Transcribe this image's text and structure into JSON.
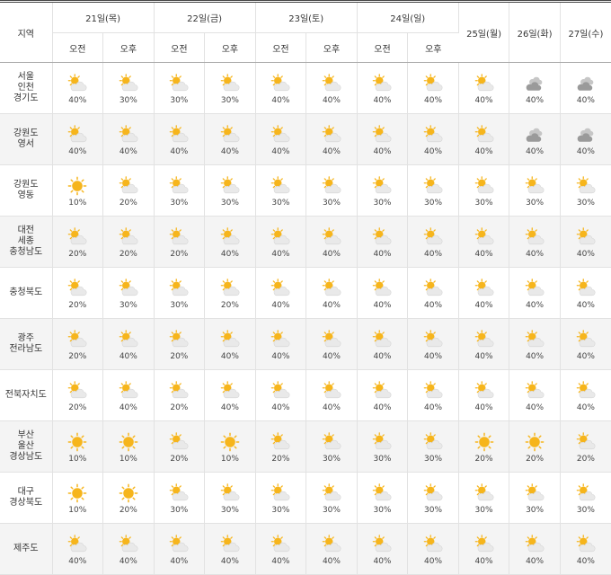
{
  "header": {
    "region_label": "지역",
    "am_label": "오전",
    "pm_label": "오후",
    "days_split": [
      "21일(목)",
      "22일(금)",
      "23일(토)",
      "24일(일)"
    ],
    "days_single": [
      "25일(월)",
      "26일(화)",
      "27일(수)"
    ]
  },
  "colors": {
    "sun": "#f6b51c",
    "cloud": "#e9e9e9",
    "cloud_dark": "#9a9a9a",
    "border": "#e2e2e2",
    "alt_row": "#f4f4f4"
  },
  "rows": [
    {
      "region": "서울\n인천\n경기도",
      "icons": [
        "partly-cloudy",
        "partly-cloudy",
        "partly-cloudy",
        "partly-cloudy",
        "partly-cloudy",
        "partly-cloudy",
        "partly-cloudy",
        "partly-cloudy",
        "partly-cloudy",
        "cloudy",
        "cloudy"
      ],
      "pops": [
        "40%",
        "30%",
        "30%",
        "30%",
        "40%",
        "40%",
        "40%",
        "40%",
        "40%",
        "40%",
        "40%"
      ]
    },
    {
      "region": "강원도\n영서",
      "icons": [
        "partly-cloudy",
        "partly-cloudy",
        "partly-cloudy",
        "partly-cloudy",
        "partly-cloudy",
        "partly-cloudy",
        "partly-cloudy",
        "partly-cloudy",
        "partly-cloudy",
        "cloudy",
        "cloudy"
      ],
      "pops": [
        "40%",
        "40%",
        "40%",
        "40%",
        "40%",
        "40%",
        "40%",
        "40%",
        "40%",
        "40%",
        "40%"
      ]
    },
    {
      "region": "강원도\n영동",
      "icons": [
        "sunny",
        "partly-cloudy",
        "partly-cloudy",
        "partly-cloudy",
        "partly-cloudy",
        "partly-cloudy",
        "partly-cloudy",
        "partly-cloudy",
        "partly-cloudy",
        "partly-cloudy",
        "partly-cloudy"
      ],
      "pops": [
        "10%",
        "20%",
        "30%",
        "30%",
        "30%",
        "30%",
        "30%",
        "30%",
        "30%",
        "30%",
        "30%"
      ]
    },
    {
      "region": "대전\n세종\n충청남도",
      "icons": [
        "partly-cloudy",
        "partly-cloudy",
        "partly-cloudy",
        "partly-cloudy",
        "partly-cloudy",
        "partly-cloudy",
        "partly-cloudy",
        "partly-cloudy",
        "partly-cloudy",
        "partly-cloudy",
        "partly-cloudy"
      ],
      "pops": [
        "20%",
        "20%",
        "20%",
        "40%",
        "40%",
        "40%",
        "40%",
        "40%",
        "40%",
        "40%",
        "40%"
      ]
    },
    {
      "region": "충청북도",
      "icons": [
        "partly-cloudy",
        "partly-cloudy",
        "partly-cloudy",
        "partly-cloudy",
        "partly-cloudy",
        "partly-cloudy",
        "partly-cloudy",
        "partly-cloudy",
        "partly-cloudy",
        "partly-cloudy",
        "partly-cloudy"
      ],
      "pops": [
        "20%",
        "30%",
        "30%",
        "20%",
        "40%",
        "40%",
        "40%",
        "40%",
        "40%",
        "40%",
        "40%"
      ]
    },
    {
      "region": "광주\n전라남도",
      "icons": [
        "partly-cloudy",
        "partly-cloudy",
        "partly-cloudy",
        "partly-cloudy",
        "partly-cloudy",
        "partly-cloudy",
        "partly-cloudy",
        "partly-cloudy",
        "partly-cloudy",
        "partly-cloudy",
        "partly-cloudy"
      ],
      "pops": [
        "20%",
        "40%",
        "20%",
        "40%",
        "40%",
        "40%",
        "40%",
        "40%",
        "40%",
        "40%",
        "40%"
      ]
    },
    {
      "region": "전북자치도",
      "icons": [
        "partly-cloudy",
        "partly-cloudy",
        "partly-cloudy",
        "partly-cloudy",
        "partly-cloudy",
        "partly-cloudy",
        "partly-cloudy",
        "partly-cloudy",
        "partly-cloudy",
        "partly-cloudy",
        "partly-cloudy"
      ],
      "pops": [
        "20%",
        "40%",
        "20%",
        "40%",
        "40%",
        "40%",
        "40%",
        "40%",
        "40%",
        "40%",
        "40%"
      ]
    },
    {
      "region": "부산\n울산\n경상남도",
      "icons": [
        "sunny",
        "sunny",
        "partly-cloudy",
        "sunny",
        "partly-cloudy",
        "partly-cloudy",
        "partly-cloudy",
        "partly-cloudy",
        "sunny",
        "sunny",
        "partly-cloudy"
      ],
      "pops": [
        "10%",
        "10%",
        "20%",
        "10%",
        "20%",
        "30%",
        "30%",
        "30%",
        "20%",
        "20%",
        "20%"
      ]
    },
    {
      "region": "대구\n경상북도",
      "icons": [
        "sunny",
        "sunny",
        "partly-cloudy",
        "partly-cloudy",
        "partly-cloudy",
        "partly-cloudy",
        "partly-cloudy",
        "partly-cloudy",
        "partly-cloudy",
        "partly-cloudy",
        "partly-cloudy"
      ],
      "pops": [
        "10%",
        "20%",
        "30%",
        "30%",
        "30%",
        "30%",
        "30%",
        "30%",
        "30%",
        "30%",
        "30%"
      ]
    },
    {
      "region": "제주도",
      "icons": [
        "partly-cloudy",
        "partly-cloudy",
        "partly-cloudy",
        "partly-cloudy",
        "partly-cloudy",
        "partly-cloudy",
        "partly-cloudy",
        "partly-cloudy",
        "partly-cloudy",
        "partly-cloudy",
        "partly-cloudy"
      ],
      "pops": [
        "40%",
        "40%",
        "40%",
        "40%",
        "40%",
        "40%",
        "40%",
        "40%",
        "40%",
        "40%",
        "40%"
      ]
    }
  ]
}
